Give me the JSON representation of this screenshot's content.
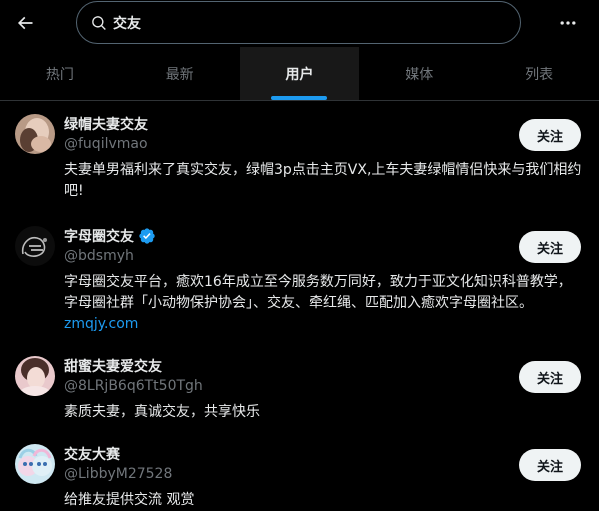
{
  "search": {
    "value": "交友"
  },
  "tabs": [
    {
      "label": "热门",
      "active": false
    },
    {
      "label": "最新",
      "active": false
    },
    {
      "label": "用户",
      "active": true
    },
    {
      "label": "媒体",
      "active": false
    },
    {
      "label": "列表",
      "active": false
    }
  ],
  "users": [
    {
      "name": "绿帽夫妻交友",
      "handle": "@fuqilvmao",
      "bio": "夫妻单男福利来了真实交友，绿帽3p点击主页VX,上车夫妻绿帽情侣快来与我们相约吧!",
      "follow_label": "关注",
      "verified": false
    },
    {
      "name": "字母圈交友",
      "handle": "@bdsmyh",
      "bio": "字母圈交友平台，癒欢16年成立至今服务数万同好，致力于亚文化知识科普教学，字母圈社群「小动物保护协会」、交友、牵红绳、匹配加入癒欢字母圈社区。",
      "bio_link": "zmqjy.com",
      "follow_label": "关注",
      "verified": true
    },
    {
      "name": "甜蜜夫妻爱交友",
      "handle": "@8LRjB6q6Tt50Tgh",
      "bio": "素质夫妻，真诚交友，共享快乐",
      "follow_label": "关注",
      "verified": false
    },
    {
      "name": "交友大赛",
      "handle": "@LibbyM27528",
      "bio": "给推友提供交流 观赏",
      "follow_label": "关注",
      "verified": false
    }
  ]
}
